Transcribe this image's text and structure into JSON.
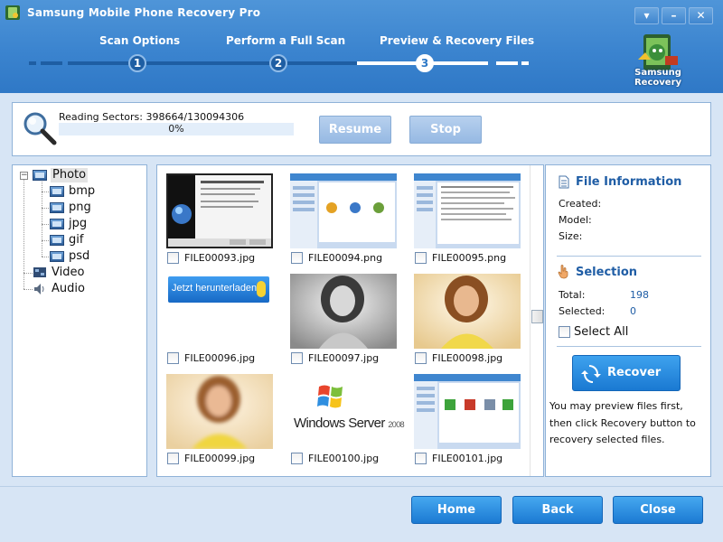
{
  "window": {
    "title": "Samsung Mobile Phone Recovery Pro",
    "controls": [
      "▾",
      "–",
      "✕"
    ]
  },
  "steps": [
    {
      "label": "Scan Options",
      "number": "1",
      "state": "done"
    },
    {
      "label": "Perform a Full Scan",
      "number": "2",
      "state": "done"
    },
    {
      "label": "Preview & Recovery Files",
      "number": "3",
      "state": "current"
    }
  ],
  "brand": {
    "line1": "Samsung",
    "line2": "Recovery"
  },
  "progress": {
    "reading_label": "Reading Sectors: 398664/130094306",
    "percent_text": "0%",
    "percent_value": 0,
    "resume_label": "Resume",
    "stop_label": "Stop"
  },
  "tree": {
    "root": "Photo",
    "children": [
      "bmp",
      "png",
      "jpg",
      "gif",
      "psd"
    ],
    "others": [
      "Video",
      "Audio"
    ]
  },
  "files": [
    {
      "name": "FILE00093.jpg",
      "thumb": "installer-dialog"
    },
    {
      "name": "FILE00094.png",
      "thumb": "app-window"
    },
    {
      "name": "FILE00095.png",
      "thumb": "app-window"
    },
    {
      "name": "FILE00096.jpg",
      "thumb": "download-banner",
      "banner_text": "Jetzt herunterladen"
    },
    {
      "name": "FILE00097.jpg",
      "thumb": "portrait-bw"
    },
    {
      "name": "FILE00098.jpg",
      "thumb": "portrait-color"
    },
    {
      "name": "FILE00099.jpg",
      "thumb": "portrait-blur"
    },
    {
      "name": "FILE00100.jpg",
      "thumb": "windows-server-logo",
      "logo_text": "Windows Server",
      "logo_year": "2008"
    },
    {
      "name": "FILE00101.jpg",
      "thumb": "app-window"
    }
  ],
  "info": {
    "file_info_title": "File Information",
    "created_label": "Created:",
    "model_label": "Model:",
    "size_label": "Size:",
    "selection_title": "Selection",
    "total_label": "Total:",
    "total_value": "198",
    "selected_label": "Selected:",
    "selected_value": "0",
    "select_all_label": "Select All",
    "recover_label": "Recover",
    "note": "You may preview files first, then click Recovery button to recovery selected files."
  },
  "footer": {
    "home_label": "Home",
    "back_label": "Back",
    "close_label": "Close"
  },
  "colors": {
    "header": "#3b84cf",
    "accent": "#1f5da5",
    "button": "#1b7ad2",
    "panel_border": "#8fb2d8"
  }
}
